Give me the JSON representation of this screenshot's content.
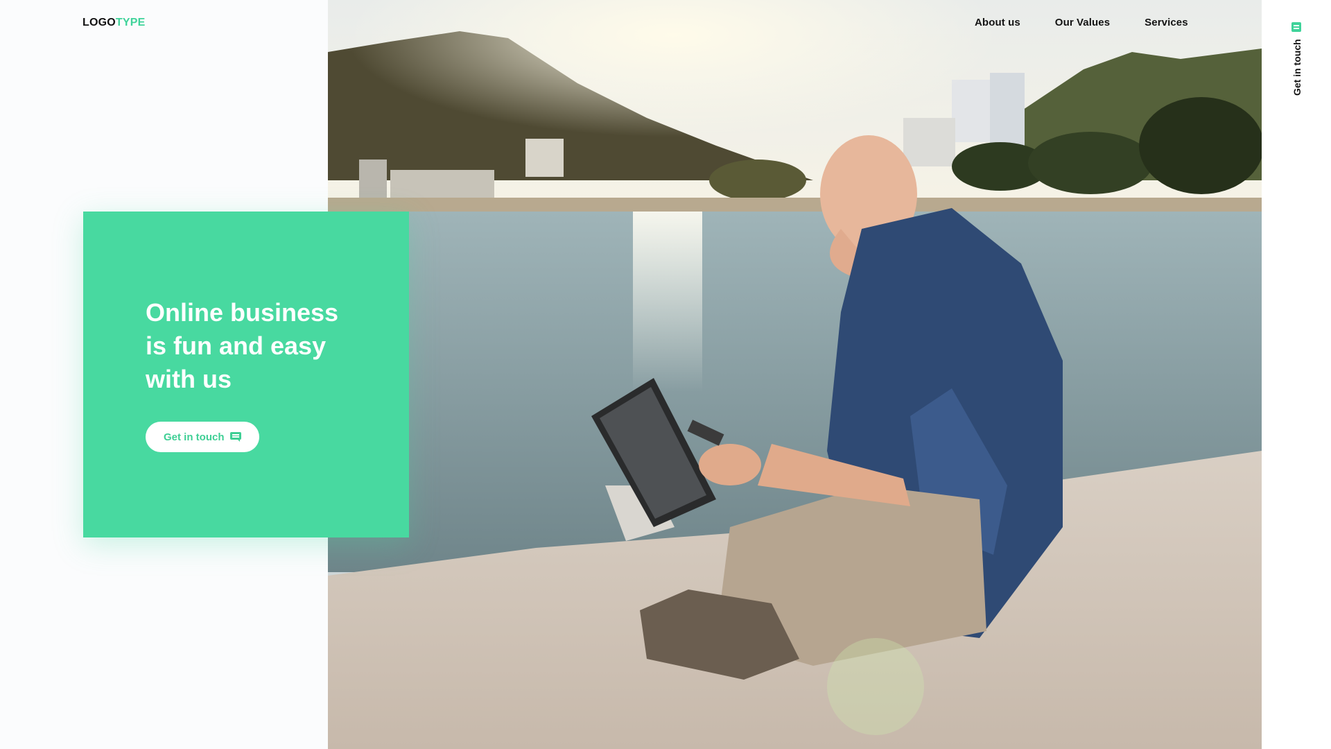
{
  "logo": {
    "part1": "LOGO",
    "part2": "TYPE"
  },
  "nav": {
    "items": [
      {
        "label": "About us"
      },
      {
        "label": "Our Values"
      },
      {
        "label": "Services"
      }
    ]
  },
  "rail": {
    "contact_label": "Get in touch"
  },
  "hero": {
    "title_lines": [
      "Online business",
      "is fun and easy",
      "with us"
    ],
    "cta_label": "Get in touch"
  },
  "colors": {
    "accent": "#48d9a0",
    "accent_text": "#3fcf95",
    "text_dark": "#141414",
    "background": "#fbfcfd"
  }
}
